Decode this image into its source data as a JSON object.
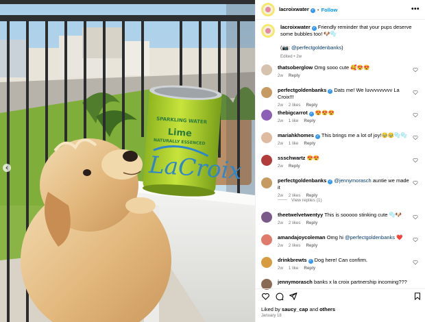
{
  "post": {
    "author": "lacroixwater",
    "follow_label": "Follow",
    "more_label": "•••",
    "dot": "•",
    "can_brand_top": "SPARKLING WATER",
    "can_brand_flavor": "Lime",
    "can_brand_sub": "NATURALLY ESSENCED",
    "can_logo": "LaCroix"
  },
  "caption": {
    "author": "lacroixwater",
    "text": "Friendly reminder that your pups deserve some bubbles too! 🐶🫧",
    "credit_prefix": "(📷: ",
    "credit_mention": "@perfectgoldenbanks",
    "credit_suffix": ")",
    "edited": "Edited",
    "age": "2w"
  },
  "comments": [
    {
      "user": "thatsoberglow",
      "verified": false,
      "text": "Omg sooo cute 🥰😍😍",
      "age": "2w",
      "likes": "",
      "reply": "Reply"
    },
    {
      "user": "perfectgoldenbanks",
      "verified": true,
      "text": "Dats me! We luvvvvvvvvv La Croix!!!",
      "age": "2w",
      "likes": "2 likes",
      "reply": "Reply"
    },
    {
      "user": "thebigcarrot",
      "verified": true,
      "text": "😍😍😍",
      "age": "2w",
      "likes": "1 like",
      "reply": "Reply"
    },
    {
      "user": "mariahkhomes",
      "verified": true,
      "text": "This brings me a lot of joy!🥹🥹🫧🫧",
      "age": "2w",
      "likes": "1 like",
      "reply": "Reply"
    },
    {
      "user": "ssschwartz",
      "verified": false,
      "text": "😍😍",
      "age": "2w",
      "likes": "",
      "reply": "Reply"
    },
    {
      "user": "perfectgoldenbanks",
      "verified": true,
      "mention": "@jennymorasch",
      "text": " auntie we made it",
      "age": "2w",
      "likes": "2 likes",
      "reply": "Reply"
    },
    {
      "user": "theetwelvetwentyy",
      "verified": false,
      "text": "This is sooooo stinking cute 🫧🐶",
      "age": "2w",
      "likes": "2 likes",
      "reply": "Reply"
    },
    {
      "user": "amandajoycoleman",
      "verified": false,
      "text": "Omg hi ",
      "mention_after": "@perfectgoldenbanks",
      "tail": " ❤️",
      "age": "2w",
      "likes": "2 likes",
      "reply": "Reply"
    },
    {
      "user": "drinkbrewts",
      "verified": true,
      "text": "Dog here! Can confirm.",
      "age": "2w",
      "likes": "1 like",
      "reply": "Reply"
    },
    {
      "user": "jennymorasch",
      "verified": false,
      "text": "banks x la croix partnership incoming???",
      "age": "",
      "likes": "",
      "reply": ""
    }
  ],
  "view_replies": "View replies (1)",
  "footer": {
    "liked_by_prefix": "Liked by ",
    "liked_by_user": "saucy_cap",
    "liked_by_and": " and ",
    "liked_by_others": "others",
    "date": "January 18"
  },
  "colors": {
    "link_blue": "#0095f6",
    "mention_blue": "#00376b",
    "meta_gray": "#737373",
    "can_green": "#b6d832",
    "can_blue": "#2f86c8"
  }
}
